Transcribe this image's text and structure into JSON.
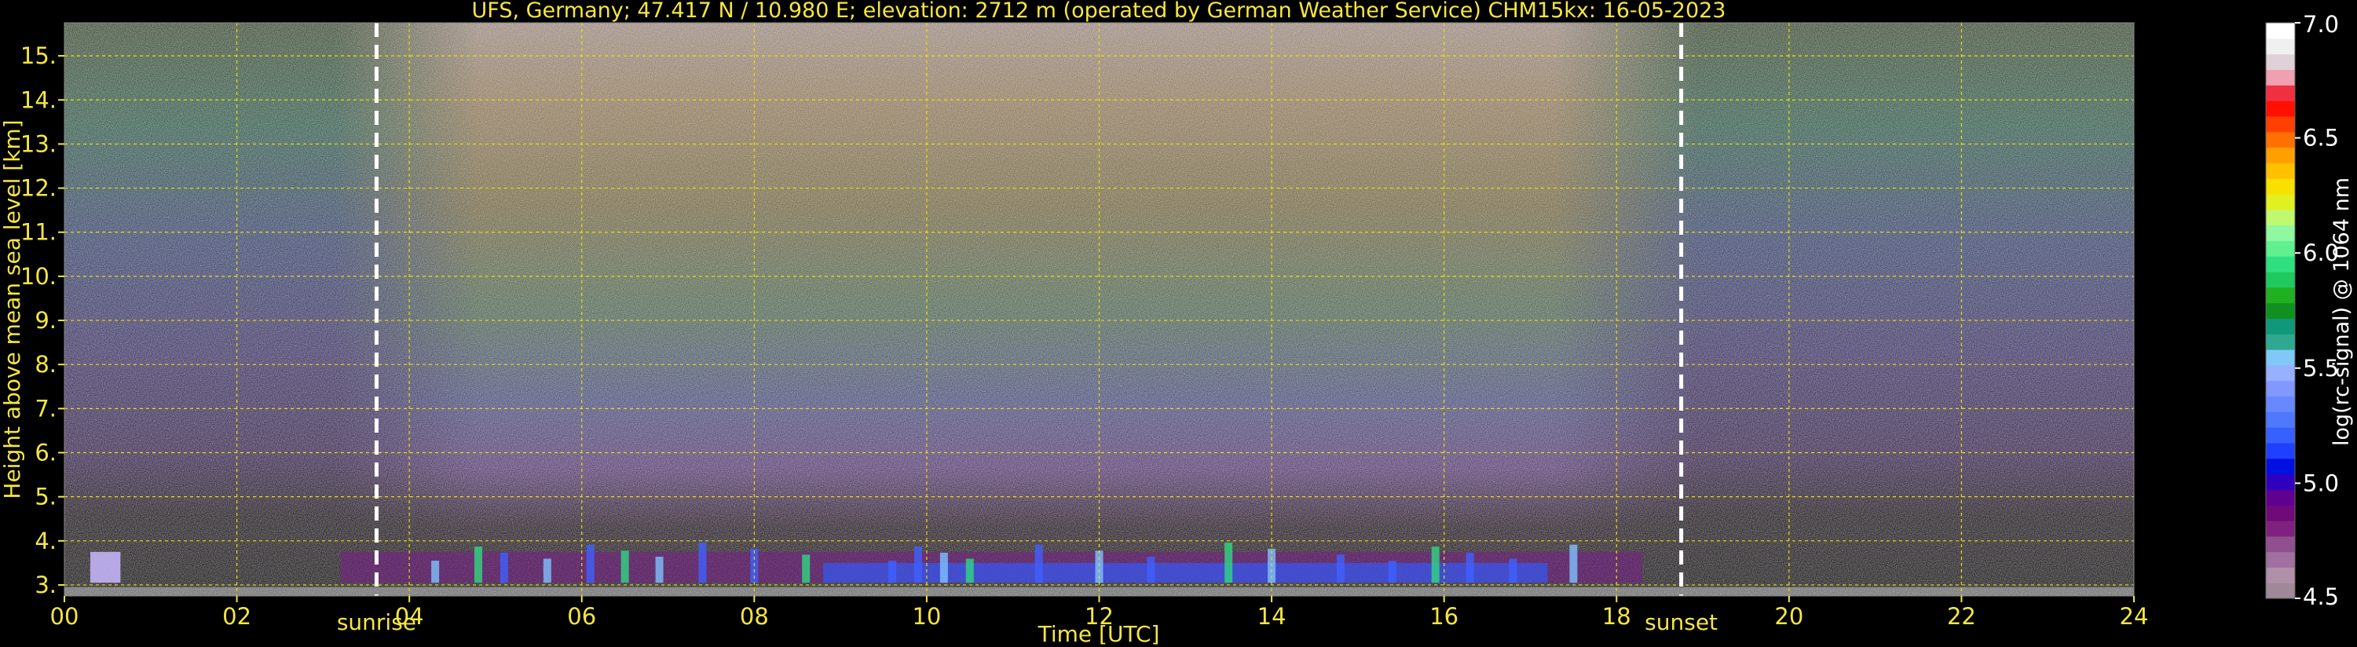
{
  "chart_data": {
    "type": "heatmap",
    "title": "UFS, Germany; 47.417 N / 10.980 E; elevation: 2712 m  (operated by German Weather Service)    CHM15kx: 16-05-2023",
    "xlabel": "Time [UTC]",
    "ylabel": "Height above mean sea level [km]",
    "xlim": [
      0,
      24
    ],
    "ylim": [
      2.75,
      15.75
    ],
    "x_ticks": [
      {
        "value": 0,
        "label": "00"
      },
      {
        "value": 2,
        "label": "02"
      },
      {
        "value": 4,
        "label": "04"
      },
      {
        "value": 6,
        "label": "06"
      },
      {
        "value": 8,
        "label": "08"
      },
      {
        "value": 10,
        "label": "10"
      },
      {
        "value": 12,
        "label": "12"
      },
      {
        "value": 14,
        "label": "14"
      },
      {
        "value": 16,
        "label": "16"
      },
      {
        "value": 18,
        "label": "18"
      },
      {
        "value": 20,
        "label": "20"
      },
      {
        "value": 22,
        "label": "22"
      },
      {
        "value": 24,
        "label": "24"
      }
    ],
    "y_ticks": [
      {
        "value": 3,
        "label": "3."
      },
      {
        "value": 4,
        "label": "4."
      },
      {
        "value": 5,
        "label": "5."
      },
      {
        "value": 6,
        "label": "6."
      },
      {
        "value": 7,
        "label": "7."
      },
      {
        "value": 8,
        "label": "8."
      },
      {
        "value": 9,
        "label": "9."
      },
      {
        "value": 10,
        "label": "10."
      },
      {
        "value": 11,
        "label": "11."
      },
      {
        "value": 12,
        "label": "12."
      },
      {
        "value": 13,
        "label": "13."
      },
      {
        "value": 14,
        "label": "14."
      },
      {
        "value": 15,
        "label": "15."
      }
    ],
    "grid": true,
    "events": [
      {
        "label": "sunrise",
        "time": 3.62
      },
      {
        "label": "sunset",
        "time": 18.75
      }
    ],
    "colorbar": {
      "label": "log(rc-signal) @ 1064 nm",
      "range": [
        4.5,
        7.0
      ],
      "ticks": [
        {
          "value": 7.0,
          "label": "7.0"
        },
        {
          "value": 6.5,
          "label": "6.5"
        },
        {
          "value": 6.0,
          "label": "6.0"
        },
        {
          "value": 5.5,
          "label": "5.5"
        },
        {
          "value": 5.0,
          "label": "5.0"
        },
        {
          "value": 4.5,
          "label": "4.5"
        }
      ],
      "colors": [
        "#a08898",
        "#b090a8",
        "#a070a0",
        "#905090",
        "#802080",
        "#700a78",
        "#600090",
        "#3000c0",
        "#0010e0",
        "#2040ff",
        "#3860ff",
        "#5078ff",
        "#6888ff",
        "#8098ff",
        "#98b0ff",
        "#80c8f8",
        "#30a890",
        "#109878",
        "#109020",
        "#20b020",
        "#20c860",
        "#30e080",
        "#60f090",
        "#90f8a0",
        "#c0f870",
        "#e0f020",
        "#f8e000",
        "#ffc000",
        "#ffa000",
        "#ff7000",
        "#ff4000",
        "#ff1000",
        "#f03040",
        "#f0a0b0",
        "#e0d0d8",
        "#f0f0f0",
        "#ffffff"
      ]
    }
  }
}
